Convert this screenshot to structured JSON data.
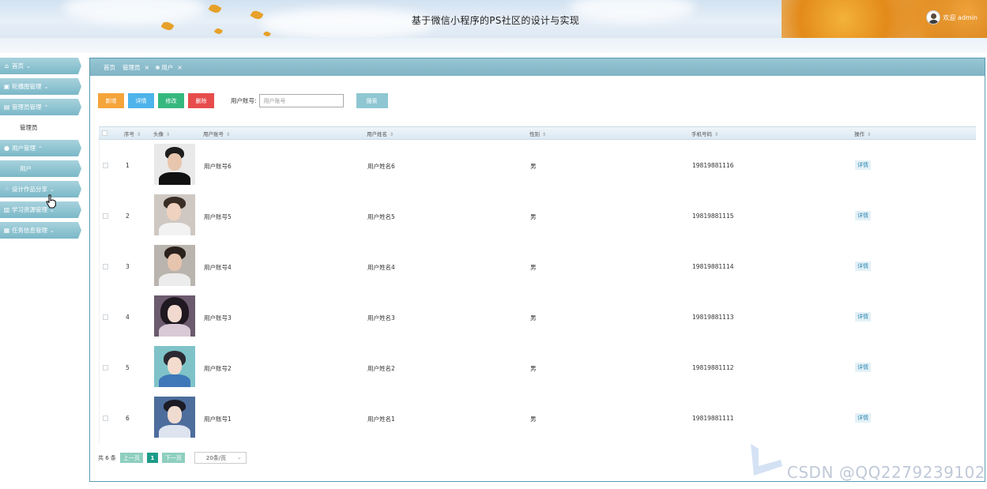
{
  "header": {
    "title": "基于微信小程序的PS社区的设计与实现",
    "welcome": "欢迎 admin"
  },
  "sidebar": {
    "items": [
      {
        "label": "首页",
        "icon": "home-icon"
      },
      {
        "label": "轮播图管理",
        "icon": "image-icon"
      },
      {
        "label": "管理员管理",
        "icon": "admin-icon",
        "open": true,
        "children": [
          {
            "label": "管理员"
          }
        ]
      },
      {
        "label": "用户管理",
        "icon": "user-icon",
        "open": true,
        "children": [
          {
            "label": "用户",
            "active": true
          }
        ]
      },
      {
        "label": "设计作品分享",
        "icon": "grid-icon"
      },
      {
        "label": "学习资源管理",
        "icon": "book-icon"
      },
      {
        "label": "任务信息管理",
        "icon": "task-icon"
      }
    ]
  },
  "tabs": {
    "items": [
      "首页",
      "管理员",
      "用户"
    ]
  },
  "toolbar": {
    "add": "新增",
    "detail": "详情",
    "edit": "修改",
    "delete": "删除",
    "search_label": "用户账号:",
    "search_placeholder": "用户账号",
    "search_button": "搜索"
  },
  "table": {
    "columns": [
      "序号",
      "头像",
      "用户账号",
      "用户姓名",
      "性别",
      "手机号码",
      "操作"
    ],
    "rows": [
      {
        "no": "1",
        "account": "用户账号6",
        "name": "用户姓名6",
        "gender": "男",
        "phone": "19819881116",
        "action": "详情"
      },
      {
        "no": "2",
        "account": "用户账号5",
        "name": "用户姓名5",
        "gender": "男",
        "phone": "19819881115",
        "action": "详情"
      },
      {
        "no": "3",
        "account": "用户账号4",
        "name": "用户姓名4",
        "gender": "男",
        "phone": "19819881114",
        "action": "详情"
      },
      {
        "no": "4",
        "account": "用户账号3",
        "name": "用户姓名3",
        "gender": "男",
        "phone": "19819881113",
        "action": "详情"
      },
      {
        "no": "5",
        "account": "用户账号2",
        "name": "用户姓名2",
        "gender": "男",
        "phone": "19819881112",
        "action": "详情"
      },
      {
        "no": "6",
        "account": "用户账号1",
        "name": "用户姓名1",
        "gender": "男",
        "phone": "19819881111",
        "action": "详情"
      }
    ]
  },
  "pager": {
    "total": "共 6 条",
    "prev": "上一页",
    "current": "1",
    "next": "下一页",
    "page_size": "20条/页"
  },
  "watermark": "CSDN @QQ2279239102",
  "colors": {
    "accent": "#7bb8c8",
    "add": "#f5a43a",
    "detail": "#4db3ea",
    "edit": "#35b87e",
    "delete": "#e74c4c"
  }
}
